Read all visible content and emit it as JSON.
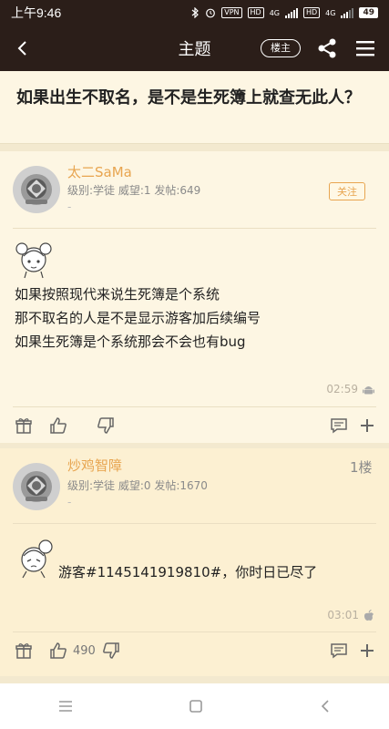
{
  "status_bar": {
    "time": "上午9:46",
    "vpn": "VPN",
    "hd1": "HD",
    "net1": "4G",
    "hd2": "HD",
    "net2": "4G",
    "battery": "49"
  },
  "header": {
    "title": "主题",
    "owner_button": "楼主"
  },
  "topic": {
    "title": "如果出生不取名，是不是生死簿上就查无此人？"
  },
  "posts": [
    {
      "username": "太二SaMa",
      "meta": "级别:学徒 威望:1 发帖:649",
      "dash": "-",
      "follow": "关注",
      "content": [
        "如果按照现代来说生死簿是个系统",
        "那不取名的人是不是显示游客加后续编号",
        "如果生死簿是个系统那会不会也有bug"
      ],
      "time": "02:59"
    },
    {
      "username": "炒鸡智障",
      "meta": "级别:学徒 威望:0 发帖:1670",
      "dash": "-",
      "floor": "1楼",
      "content": [
        "游客#1145141919810#，你时日已尽了"
      ],
      "time": "03:01",
      "likes": "490"
    }
  ]
}
